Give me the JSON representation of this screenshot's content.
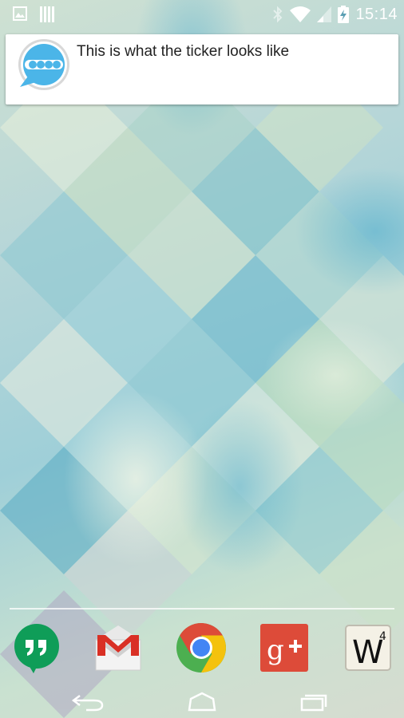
{
  "status_bar": {
    "time": "15:14",
    "icons": [
      "image-notification-icon",
      "barcode-notification-icon",
      "bluetooth-icon",
      "wifi-icon",
      "cell-signal-icon",
      "battery-charging-icon"
    ]
  },
  "ticker": {
    "text": "This is what the ticker looks like",
    "icon": "chat-bubble-app-icon"
  },
  "dock": {
    "apps": [
      {
        "icon": "hangouts-icon",
        "color": "#0f9d58"
      },
      {
        "icon": "gmail-icon",
        "color": "#d93025"
      },
      {
        "icon": "chrome-icon",
        "color": "#4285f4"
      },
      {
        "icon": "google-plus-icon",
        "color": "#dd4b39"
      },
      {
        "icon": "words-tile-icon",
        "letter": "W",
        "superscript": "4"
      }
    ]
  },
  "nav_bar": {
    "buttons": [
      "back-icon",
      "home-icon",
      "recents-icon"
    ]
  },
  "colors": {
    "ticker_bubble": "#4bb5e8",
    "wallpaper_base": "#9fcfd8"
  }
}
